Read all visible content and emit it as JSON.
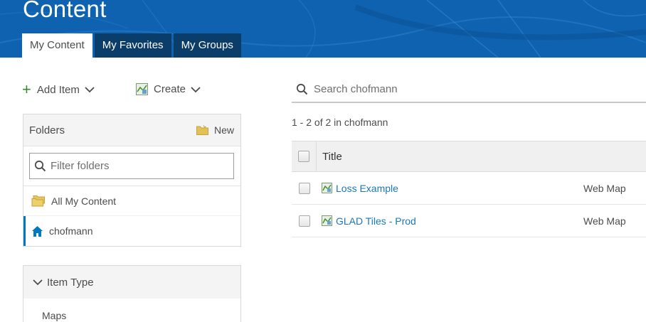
{
  "header": {
    "title": "Content",
    "tabs": [
      {
        "label": "My Content",
        "active": true
      },
      {
        "label": "My Favorites",
        "active": false
      },
      {
        "label": "My Groups",
        "active": false
      }
    ],
    "banner_color": "#0e62b0"
  },
  "toolbar": {
    "add_item_label": "Add Item",
    "create_label": "Create"
  },
  "folders": {
    "heading": "Folders",
    "new_label": "New",
    "filter_placeholder": "Filter folders",
    "items": [
      {
        "label": "All My Content",
        "icon": "folders-icon",
        "selected": false
      },
      {
        "label": "chofmann",
        "icon": "home-icon",
        "selected": true
      }
    ]
  },
  "item_type": {
    "heading": "Item Type",
    "options": [
      "Maps"
    ]
  },
  "search": {
    "placeholder": "Search chofmann"
  },
  "results": {
    "count_text": "1 - 2 of 2 in chofmann",
    "column_title": "Title",
    "rows": [
      {
        "title": "Loss Example",
        "type": "Web Map"
      },
      {
        "title": "GLAD Tiles - Prod",
        "type": "Web Map"
      }
    ]
  },
  "colors": {
    "accent": "#0079c1",
    "link": "#1a78b8",
    "plus_green": "#3a8a34",
    "tab_dark": "#0b3d6b"
  }
}
